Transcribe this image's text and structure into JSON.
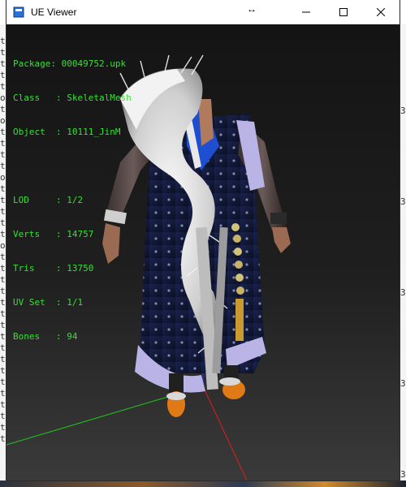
{
  "window": {
    "title": "UE Viewer",
    "controls": {
      "minimize": "—",
      "maximize": "☐",
      "close": "✕"
    },
    "cursor_glyph": "↔"
  },
  "info": {
    "package": {
      "label": "Package",
      "value": "00049752.upk"
    },
    "class": {
      "label": "Class",
      "value": "SkeletalMesh"
    },
    "object": {
      "label": "Object",
      "value": "10111_JinM"
    },
    "lod": {
      "label": "LOD",
      "value": "1/2"
    },
    "verts": {
      "label": "Verts",
      "value": "14757"
    },
    "tris": {
      "label": "Tris",
      "value": "13750"
    },
    "uvset": {
      "label": "UV Set",
      "value": "1/1"
    },
    "bones": {
      "label": "Bones",
      "value": "94"
    }
  },
  "background_left_glyphs": [
    "t",
    "t",
    "t",
    "t",
    "t",
    "o",
    "t",
    "o",
    "t",
    "t",
    "t",
    "t",
    "o",
    "t",
    "t",
    "t",
    "t",
    "t",
    "o",
    "t",
    "t",
    "t",
    "t",
    "t",
    "t",
    "t",
    "t",
    "t",
    "t",
    "t",
    "t",
    "t",
    "t",
    "t",
    "t",
    "t"
  ],
  "background_right_glyphs": [
    "3",
    "3",
    "3",
    "3",
    "3"
  ],
  "colors": {
    "info_text": "#33e233",
    "axis_x": "#e01e1e",
    "axis_y": "#1ec81e",
    "axis_z": "#2030ff"
  }
}
